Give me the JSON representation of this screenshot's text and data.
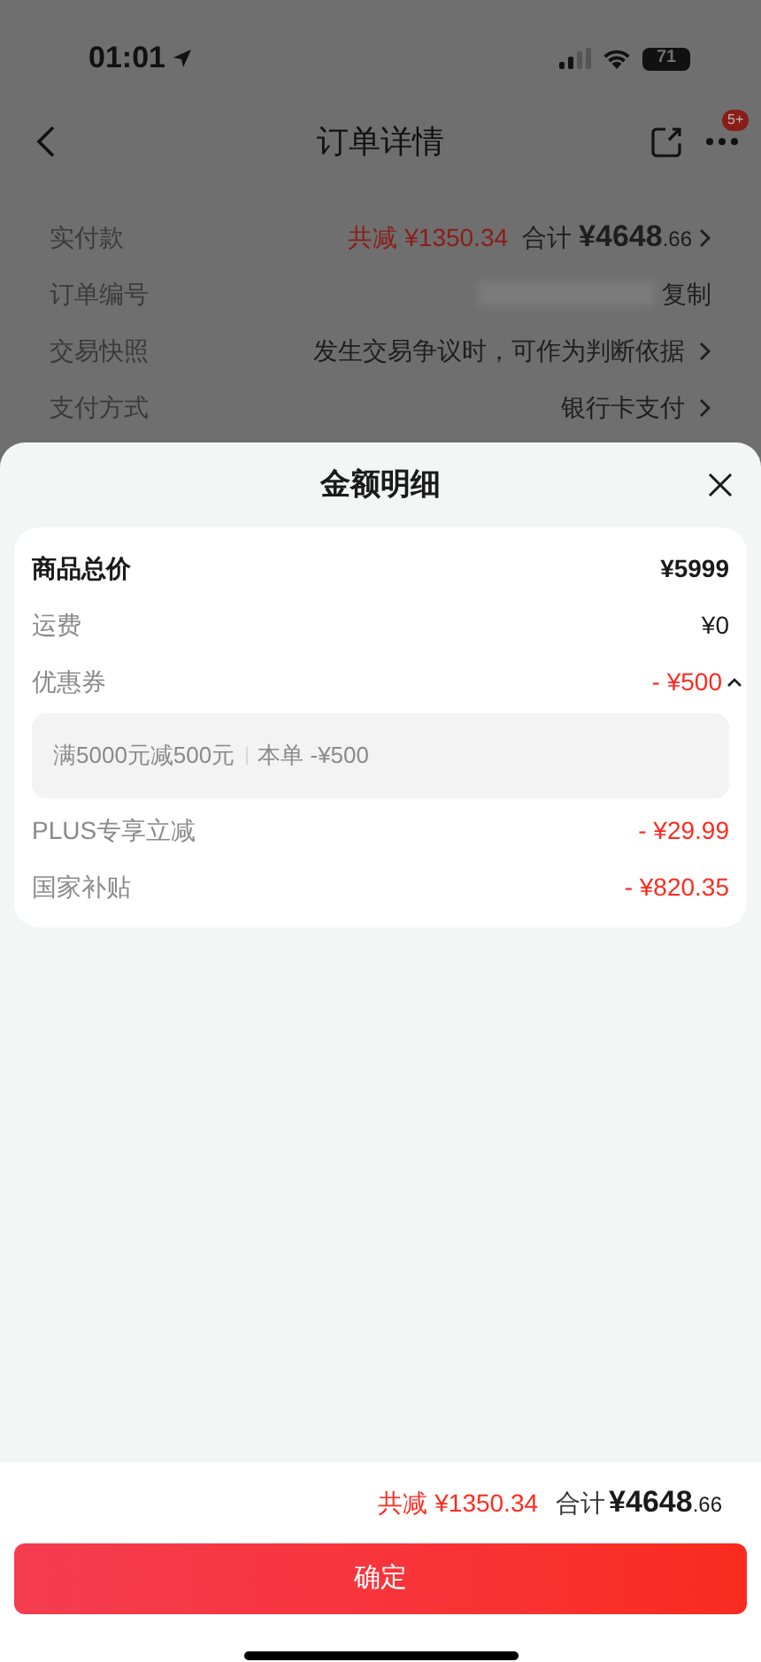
{
  "status_bar": {
    "time": "01:01",
    "battery": "71"
  },
  "nav": {
    "title": "订单详情",
    "badge": "5+"
  },
  "order_rows": [
    {
      "kind": "total",
      "label": "实付款",
      "discount": "共减 ¥1350.34",
      "total_label": "合计",
      "total_int": "¥4648",
      "total_dec": ".66"
    },
    {
      "kind": "copy",
      "label": "订单编号",
      "value": "复制"
    },
    {
      "kind": "link",
      "label": "交易快照",
      "value": "发生交易争议时，可作为判断依据"
    },
    {
      "kind": "link",
      "label": "支付方式",
      "value": "银行卡支付"
    }
  ],
  "sheet": {
    "title": "金额明细",
    "items": [
      {
        "kind": "main",
        "label": "商品总价",
        "value": "¥5999"
      },
      {
        "kind": "plain",
        "label": "运费",
        "value": "¥0"
      },
      {
        "kind": "discount",
        "label": "优惠券",
        "value": "- ¥500",
        "expanded": true,
        "details": [
          {
            "rule": "满5000元减500元",
            "amount": "本单 -¥500"
          }
        ]
      },
      {
        "kind": "discount",
        "label": "PLUS专享立减",
        "value": "- ¥29.99"
      },
      {
        "kind": "discount",
        "label": "国家补贴",
        "value": "- ¥820.35"
      }
    ]
  },
  "footer": {
    "discount": "共减 ¥1350.34",
    "total_label": "合计",
    "total_int": "¥4648",
    "total_dec": ".66",
    "button": "确定"
  }
}
